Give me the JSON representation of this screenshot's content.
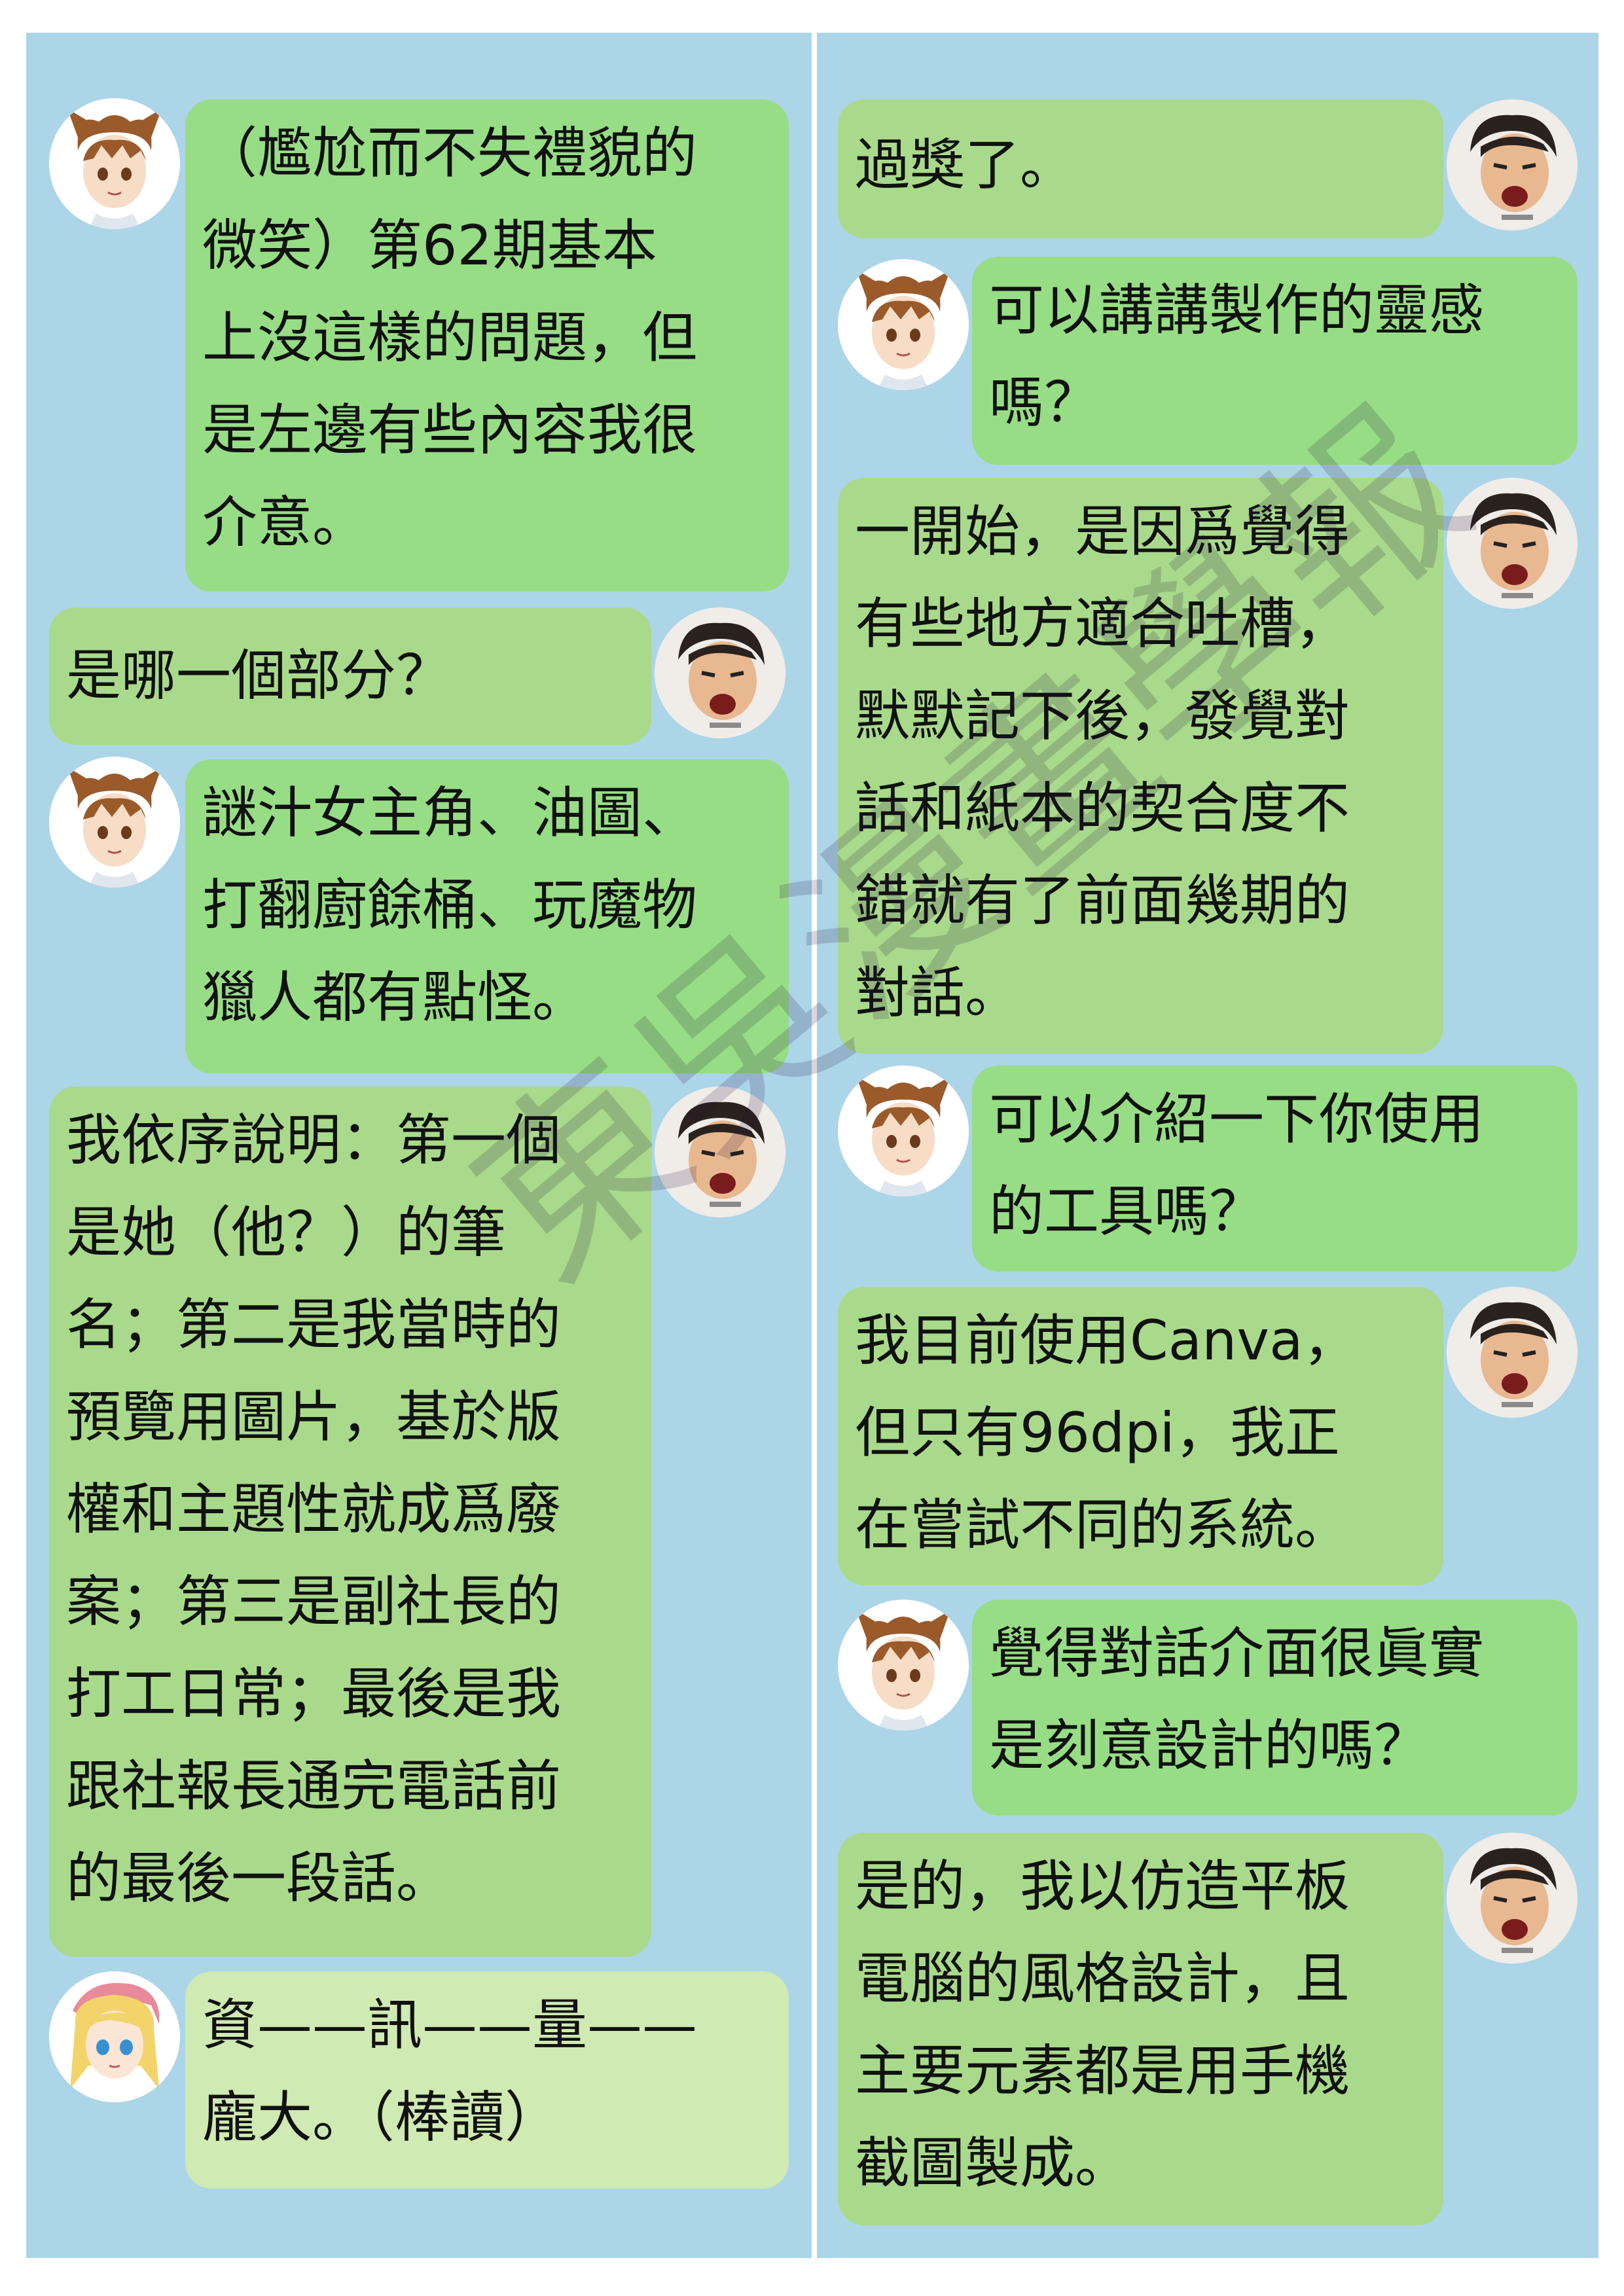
{
  "conversation": {
    "left": [
      {
        "speaker": "cat-boy",
        "text": "（尷尬而不失禮貌的\n微笑）第62期基本\n上沒這樣的問題，但\n是左邊有些內容我很\n介意。"
      },
      {
        "speaker": "editor",
        "text": "是哪一個部分？"
      },
      {
        "speaker": "cat-boy",
        "text": "謎汁女主角、油圖、\n打翻廚餘桶、玩魔物\n獵人都有點怪。"
      },
      {
        "speaker": "editor",
        "text": "我依序說明：第一個\n是她（他？）的筆\n名；第二是我當時的\n預覽用圖片，基於版\n權和主題性就成爲廢\n案；第三是副社長的\n打工日常；最後是我\n跟社報長通完電話前\n的最後一段話。"
      },
      {
        "speaker": "blonde-girl",
        "text": "資——訊——量——\n龐大。（棒讀）"
      }
    ],
    "right": [
      {
        "speaker": "editor",
        "text": "過獎了。"
      },
      {
        "speaker": "cat-boy",
        "text": "可以講講製作的靈感\n嗎？"
      },
      {
        "speaker": "editor",
        "text": "一開始，是因爲覺得\n有些地方適合吐槽，\n默默記下後，發覺對\n話和紙本的契合度不\n錯就有了前面幾期的\n對話。"
      },
      {
        "speaker": "cat-boy",
        "text": "可以介紹一下你使用\n的工具嗎？"
      },
      {
        "speaker": "editor",
        "text": "我目前使用Canva，\n但只有96dpi，我正\n在嘗試不同的系統。"
      },
      {
        "speaker": "cat-boy",
        "text": "覺得對話介面很眞實\n是刻意設計的嗎？"
      },
      {
        "speaker": "editor",
        "text": "是的，我以仿造平板\n電腦的風格設計，且\n主要元素都是用手機\n截圖製成。"
      }
    ]
  },
  "watermark": {
    "text": "東吳漫畫學報"
  },
  "colors": {
    "background": "#acd5e8",
    "bubble_green": "#97dd85",
    "bubble_olive": "#a9da8b",
    "bubble_light": "#cfeab2"
  }
}
